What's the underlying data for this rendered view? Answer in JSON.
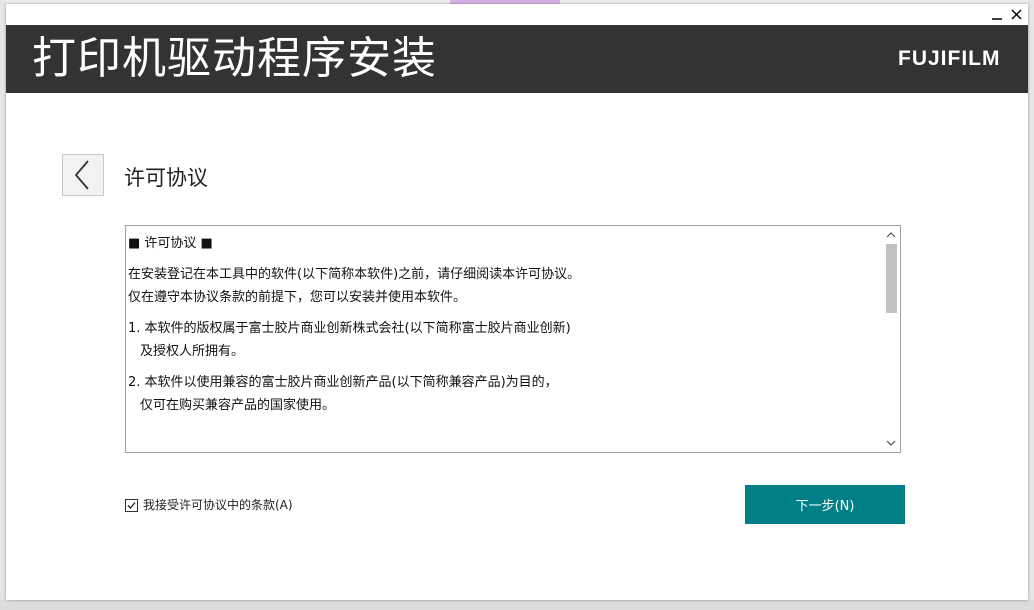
{
  "app": {
    "header_title": "打印机驱动程序安装",
    "brand": "FUJIFILM"
  },
  "window_controls": {
    "minimize_icon": "minimize-icon",
    "close_icon": "close-icon"
  },
  "page": {
    "title": "许可协议",
    "back_icon": "chevron-left-icon"
  },
  "license": {
    "paragraphs": [
      [
        "■ 许可协议 ■"
      ],
      [
        "在安装登记在本工具中的软件(以下简称本软件)之前，请仔细阅读本许可协议。",
        "仅在遵守本协议条款的前提下，您可以安装并使用本软件。"
      ],
      [
        "1. 本软件的版权属于富士胶片商业创新株式会社(以下简称富士胶片商业创新)",
        "及授权人所拥有。"
      ],
      [
        "2. 本软件以使用兼容的富士胶片商业创新产品(以下简称兼容产品)为目的，",
        "仅可在购买兼容产品的国家使用。"
      ]
    ]
  },
  "agreement": {
    "checked": true,
    "label": "我接受许可协议中的条款(A)"
  },
  "actions": {
    "next_label": "下一步(N)"
  },
  "colors": {
    "header_bg": "#333333",
    "accent": "#007f86"
  }
}
